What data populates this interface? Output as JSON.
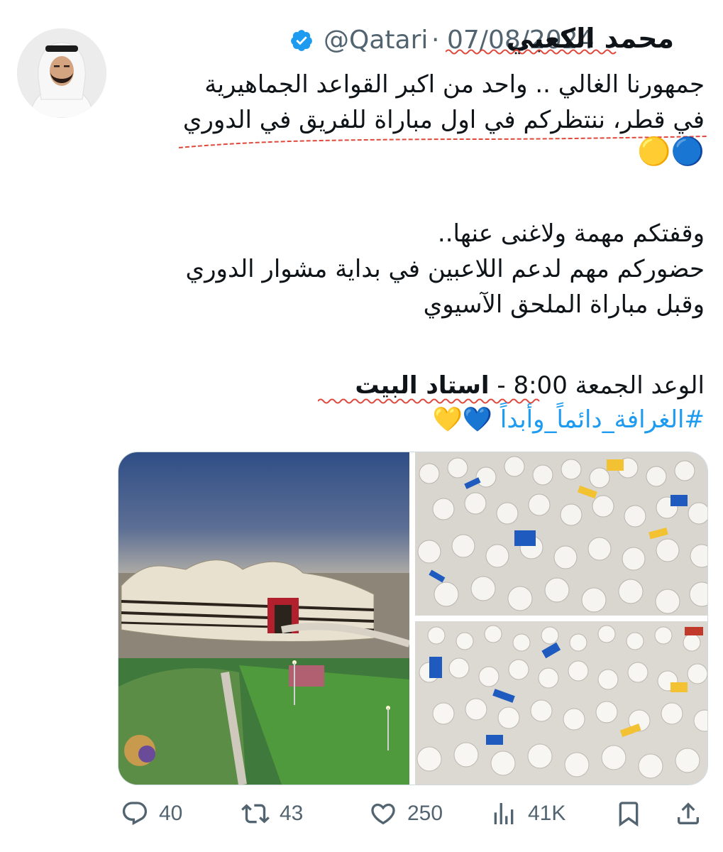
{
  "tweet": {
    "author": {
      "display_name": "محمد الكعبي",
      "handle": "@Qatari",
      "verified": true
    },
    "separator": "·",
    "date": "07/08/2024",
    "lines": [
      "جمهورنا الغالي .. واحد من اكبر القواعد الجماهيرية",
      "في قطر، ننتظركم في اول مباراة للفريق في الدوري",
      "🔵🟡",
      "وقفتكم مهمة ولاغنى عنها..",
      "حضوركم مهم لدعم اللاعبين في بداية مشوار الدوري",
      "وقبل مباراة الملحق الآسيوي"
    ],
    "appointment_prefix": "الوعد الجمعة 8:00 - ",
    "appointment_venue": "استاد البيت",
    "hashtag": "#الغرافة_دائماً_وأبداً",
    "hashtag_emojis": "💙💛"
  },
  "media": [
    {
      "name": "stadium-photo",
      "icon": "al-bayt-stadium-aerial"
    },
    {
      "name": "crowd-photo-1",
      "icon": "fans-in-stands"
    },
    {
      "name": "crowd-photo-2",
      "icon": "fans-in-stands"
    }
  ],
  "actions": {
    "replies": "40",
    "reposts": "43",
    "likes": "250",
    "views": "41K"
  },
  "colors": {
    "text": "#0f1419",
    "secondary": "#536471",
    "link": "#1d9bf0",
    "verified": "#1d9bf0",
    "squiggle": "#e0483c"
  }
}
